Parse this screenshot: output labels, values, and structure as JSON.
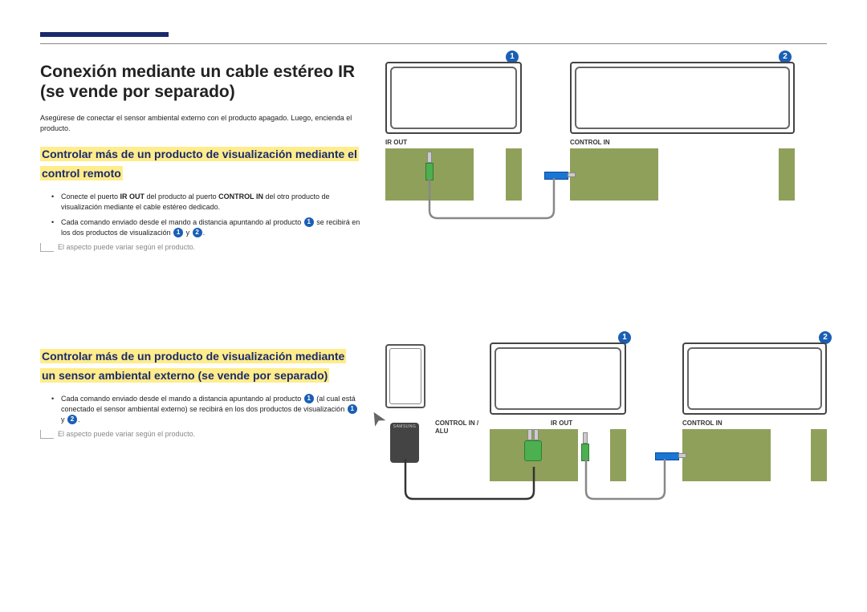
{
  "accent_color": "#1a2a6c",
  "highlight_color": "#ffec8b",
  "header": {
    "title": "Conexión mediante un cable estéreo IR (se vende por separado)"
  },
  "intro": "Asegúrese de conectar el sensor ambiental externo con el producto apagado. Luego, encienda el producto.",
  "section1": {
    "heading": "Controlar más de un producto de visualización mediante el control remoto",
    "bullets": {
      "b1_pre": "Conecte el puerto ",
      "b1_bold1": "IR OUT",
      "b1_mid": " del producto al puerto ",
      "b1_bold2": "CONTROL IN",
      "b1_post": " del otro producto de visualización mediante el cable estéreo dedicado.",
      "b2_pre": "Cada comando enviado desde el mando a distancia apuntando al producto ",
      "b2_mid": " se recibirá en los dos productos de visualización ",
      "b2_y": " y ",
      "b2_end": "."
    },
    "note": "El aspecto puede variar según el producto."
  },
  "section2": {
    "heading": "Controlar más de un producto de visualización mediante un sensor ambiental externo (se vende por separado)",
    "bullets": {
      "b1_pre": "Cada comando enviado desde el mando a distancia apuntando al producto ",
      "b1_mid": " (al cual está conectado el sensor ambiental externo) se recibirá en los dos productos de visualización ",
      "b1_y": " y ",
      "b1_end": "."
    },
    "note": "El aspecto puede variar según el producto."
  },
  "diagram1": {
    "badge1": "1",
    "badge2": "2",
    "label_irout": "IR OUT",
    "label_controlin": "CONTROL IN"
  },
  "diagram2": {
    "badge1": "1",
    "badge2": "2",
    "label_controlin_alu": "CONTROL IN / ALU",
    "label_irout": "IR OUT",
    "label_controlin": "CONTROL IN",
    "sensor_brand": "SAMSUNG"
  },
  "inline_badges": {
    "one": "1",
    "two": "2"
  }
}
